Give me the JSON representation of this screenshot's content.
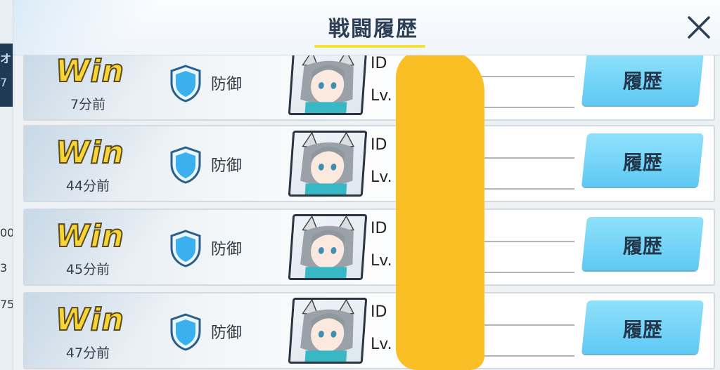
{
  "title": "戦闘履歴",
  "close_icon": "close-icon",
  "colors": {
    "win": "#f8d534",
    "button": "#5fc9f4",
    "underline": "#f3e23a",
    "redaction": "#fbbf26"
  },
  "background_fragments": [
    "オ",
    "7",
    "00",
    "3",
    "75"
  ],
  "battles": [
    {
      "result": "Win",
      "time": "7分前",
      "role": "防御",
      "id_label": "ID",
      "lv_label": "Lv.",
      "button": "履歴"
    },
    {
      "result": "Win",
      "time": "44分前",
      "role": "防御",
      "id_label": "ID",
      "lv_label": "Lv.",
      "button": "履歴"
    },
    {
      "result": "Win",
      "time": "45分前",
      "role": "防御",
      "id_label": "ID",
      "lv_label": "Lv.",
      "button": "履歴"
    },
    {
      "result": "Win",
      "time": "47分前",
      "role": "防御",
      "id_label": "ID",
      "lv_label": "Lv.",
      "button": "履歴"
    }
  ]
}
